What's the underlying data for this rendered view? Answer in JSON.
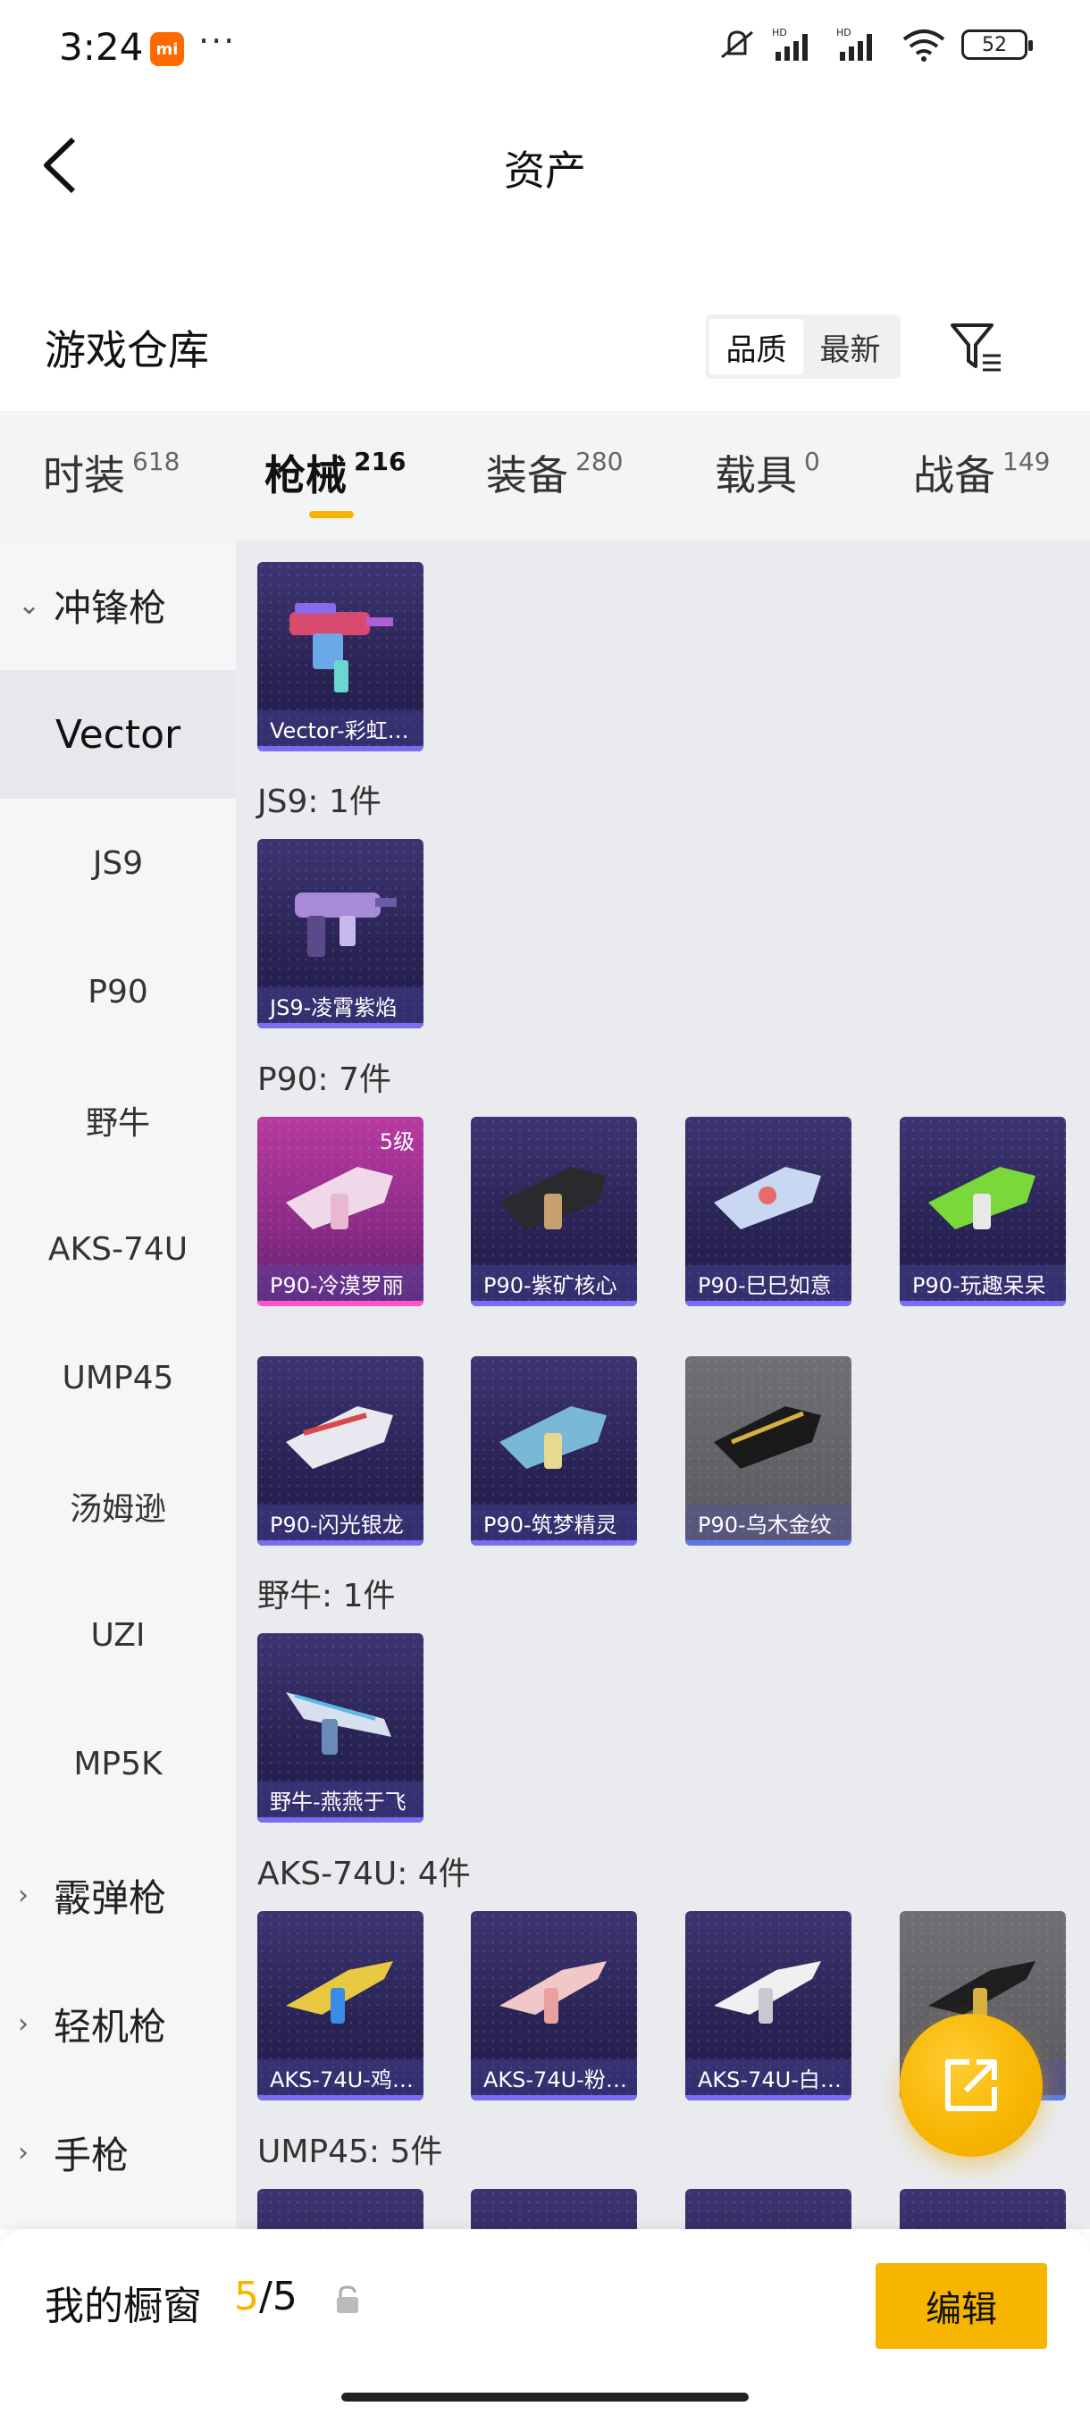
{
  "status_bar": {
    "time": "3:24",
    "app_badge": "mi",
    "more": "···",
    "battery": "52"
  },
  "header": {
    "title": "资产",
    "back_icon": "chevron-left-icon"
  },
  "section": {
    "title": "游戏仓库",
    "sort_options": [
      "品质",
      "最新"
    ],
    "active_sort": "品质",
    "filter_icon": "filter-icon"
  },
  "tabs": [
    {
      "label": "时装",
      "count": "618"
    },
    {
      "label": "枪械",
      "count": "216",
      "active": true
    },
    {
      "label": "装备",
      "count": "280"
    },
    {
      "label": "载具",
      "count": "0"
    },
    {
      "label": "战备",
      "count": "149"
    }
  ],
  "sidebar": {
    "group_open": "冲锋枪",
    "items": [
      "Vector",
      "JS9",
      "P90",
      "野牛",
      "AKS-74U",
      "UMP45",
      "汤姆逊",
      "UZI",
      "MP5K"
    ],
    "active_item": "Vector",
    "groups_closed": [
      "霰弹枪",
      "轻机枪",
      "手枪"
    ]
  },
  "content": {
    "groups": [
      {
        "header": "",
        "items": [
          {
            "name": "Vector-彩虹…"
          }
        ]
      },
      {
        "header": "JS9: 1件",
        "items": [
          {
            "name": "JS9-凌霄紫焰"
          }
        ]
      },
      {
        "header": "P90: 7件",
        "items": [
          {
            "name": "P90-冷漠罗丽",
            "level": "5级"
          },
          {
            "name": "P90-紫矿核心"
          },
          {
            "name": "P90-巳巳如意"
          },
          {
            "name": "P90-玩趣呆呆"
          },
          {
            "name": "P90-闪光银龙"
          },
          {
            "name": "P90-筑梦精灵"
          },
          {
            "name": "P90-乌木金纹"
          }
        ]
      },
      {
        "header": "野牛: 1件",
        "items": [
          {
            "name": "野牛-燕燕于飞"
          }
        ]
      },
      {
        "header": "AKS-74U: 4件",
        "items": [
          {
            "name": "AKS-74U-鸡…"
          },
          {
            "name": "AKS-74U-粉…"
          },
          {
            "name": "AKS-74U-白…"
          },
          {
            "name": "…"
          }
        ]
      },
      {
        "header": "UMP45: 5件",
        "items": []
      }
    ]
  },
  "fab": {
    "icon": "share-external-icon"
  },
  "bottom_bar": {
    "label": "我的橱窗",
    "current": "5",
    "separator": "/",
    "total": "5",
    "edit_label": "编辑"
  },
  "colors": {
    "accent": "#f7b500",
    "card_bg": "#2a2456",
    "card_pink": "#8a2a86",
    "card_gray": "#58585e"
  }
}
